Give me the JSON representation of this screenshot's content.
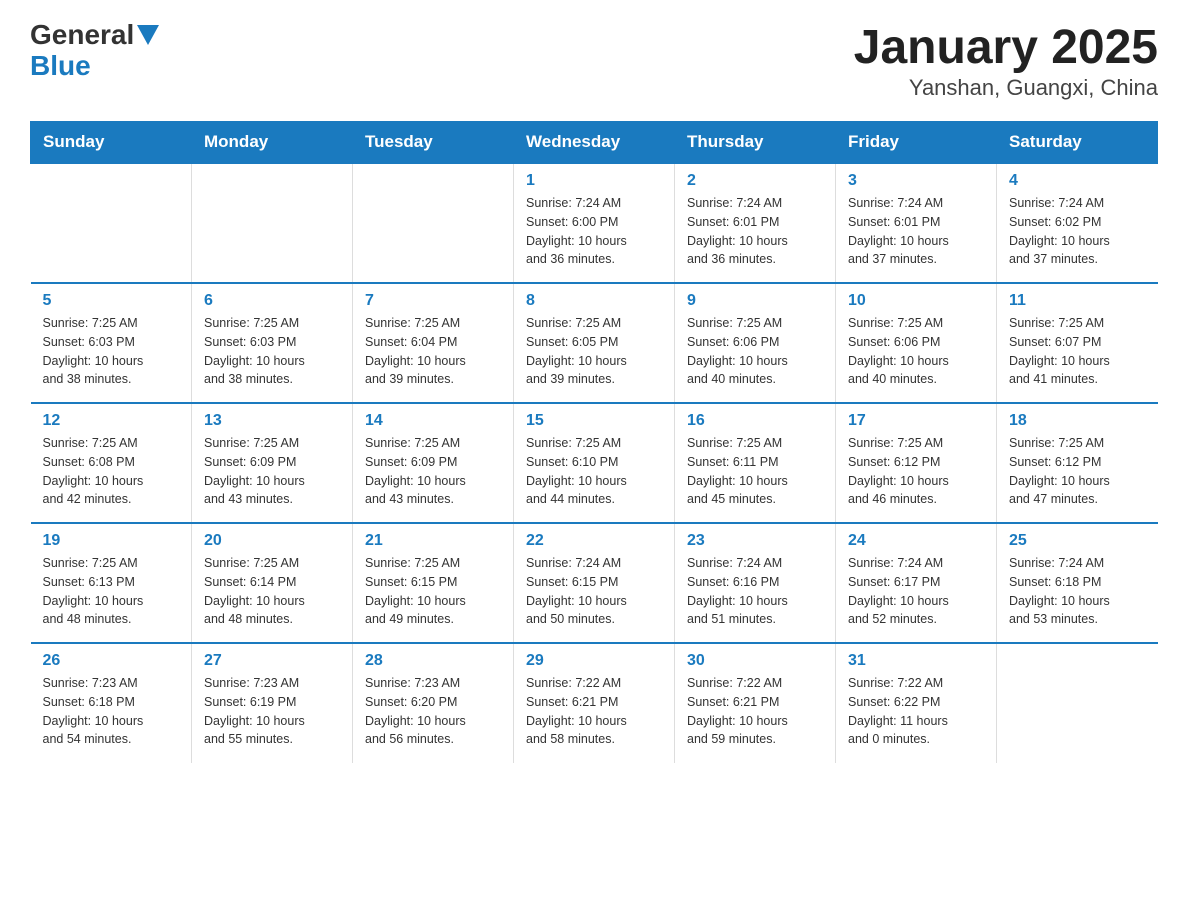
{
  "logo": {
    "general": "General",
    "blue": "Blue"
  },
  "header": {
    "title": "January 2025",
    "subtitle": "Yanshan, Guangxi, China"
  },
  "days_of_week": [
    "Sunday",
    "Monday",
    "Tuesday",
    "Wednesday",
    "Thursday",
    "Friday",
    "Saturday"
  ],
  "weeks": [
    [
      {
        "day": "",
        "info": ""
      },
      {
        "day": "",
        "info": ""
      },
      {
        "day": "",
        "info": ""
      },
      {
        "day": "1",
        "info": "Sunrise: 7:24 AM\nSunset: 6:00 PM\nDaylight: 10 hours\nand 36 minutes."
      },
      {
        "day": "2",
        "info": "Sunrise: 7:24 AM\nSunset: 6:01 PM\nDaylight: 10 hours\nand 36 minutes."
      },
      {
        "day": "3",
        "info": "Sunrise: 7:24 AM\nSunset: 6:01 PM\nDaylight: 10 hours\nand 37 minutes."
      },
      {
        "day": "4",
        "info": "Sunrise: 7:24 AM\nSunset: 6:02 PM\nDaylight: 10 hours\nand 37 minutes."
      }
    ],
    [
      {
        "day": "5",
        "info": "Sunrise: 7:25 AM\nSunset: 6:03 PM\nDaylight: 10 hours\nand 38 minutes."
      },
      {
        "day": "6",
        "info": "Sunrise: 7:25 AM\nSunset: 6:03 PM\nDaylight: 10 hours\nand 38 minutes."
      },
      {
        "day": "7",
        "info": "Sunrise: 7:25 AM\nSunset: 6:04 PM\nDaylight: 10 hours\nand 39 minutes."
      },
      {
        "day": "8",
        "info": "Sunrise: 7:25 AM\nSunset: 6:05 PM\nDaylight: 10 hours\nand 39 minutes."
      },
      {
        "day": "9",
        "info": "Sunrise: 7:25 AM\nSunset: 6:06 PM\nDaylight: 10 hours\nand 40 minutes."
      },
      {
        "day": "10",
        "info": "Sunrise: 7:25 AM\nSunset: 6:06 PM\nDaylight: 10 hours\nand 40 minutes."
      },
      {
        "day": "11",
        "info": "Sunrise: 7:25 AM\nSunset: 6:07 PM\nDaylight: 10 hours\nand 41 minutes."
      }
    ],
    [
      {
        "day": "12",
        "info": "Sunrise: 7:25 AM\nSunset: 6:08 PM\nDaylight: 10 hours\nand 42 minutes."
      },
      {
        "day": "13",
        "info": "Sunrise: 7:25 AM\nSunset: 6:09 PM\nDaylight: 10 hours\nand 43 minutes."
      },
      {
        "day": "14",
        "info": "Sunrise: 7:25 AM\nSunset: 6:09 PM\nDaylight: 10 hours\nand 43 minutes."
      },
      {
        "day": "15",
        "info": "Sunrise: 7:25 AM\nSunset: 6:10 PM\nDaylight: 10 hours\nand 44 minutes."
      },
      {
        "day": "16",
        "info": "Sunrise: 7:25 AM\nSunset: 6:11 PM\nDaylight: 10 hours\nand 45 minutes."
      },
      {
        "day": "17",
        "info": "Sunrise: 7:25 AM\nSunset: 6:12 PM\nDaylight: 10 hours\nand 46 minutes."
      },
      {
        "day": "18",
        "info": "Sunrise: 7:25 AM\nSunset: 6:12 PM\nDaylight: 10 hours\nand 47 minutes."
      }
    ],
    [
      {
        "day": "19",
        "info": "Sunrise: 7:25 AM\nSunset: 6:13 PM\nDaylight: 10 hours\nand 48 minutes."
      },
      {
        "day": "20",
        "info": "Sunrise: 7:25 AM\nSunset: 6:14 PM\nDaylight: 10 hours\nand 48 minutes."
      },
      {
        "day": "21",
        "info": "Sunrise: 7:25 AM\nSunset: 6:15 PM\nDaylight: 10 hours\nand 49 minutes."
      },
      {
        "day": "22",
        "info": "Sunrise: 7:24 AM\nSunset: 6:15 PM\nDaylight: 10 hours\nand 50 minutes."
      },
      {
        "day": "23",
        "info": "Sunrise: 7:24 AM\nSunset: 6:16 PM\nDaylight: 10 hours\nand 51 minutes."
      },
      {
        "day": "24",
        "info": "Sunrise: 7:24 AM\nSunset: 6:17 PM\nDaylight: 10 hours\nand 52 minutes."
      },
      {
        "day": "25",
        "info": "Sunrise: 7:24 AM\nSunset: 6:18 PM\nDaylight: 10 hours\nand 53 minutes."
      }
    ],
    [
      {
        "day": "26",
        "info": "Sunrise: 7:23 AM\nSunset: 6:18 PM\nDaylight: 10 hours\nand 54 minutes."
      },
      {
        "day": "27",
        "info": "Sunrise: 7:23 AM\nSunset: 6:19 PM\nDaylight: 10 hours\nand 55 minutes."
      },
      {
        "day": "28",
        "info": "Sunrise: 7:23 AM\nSunset: 6:20 PM\nDaylight: 10 hours\nand 56 minutes."
      },
      {
        "day": "29",
        "info": "Sunrise: 7:22 AM\nSunset: 6:21 PM\nDaylight: 10 hours\nand 58 minutes."
      },
      {
        "day": "30",
        "info": "Sunrise: 7:22 AM\nSunset: 6:21 PM\nDaylight: 10 hours\nand 59 minutes."
      },
      {
        "day": "31",
        "info": "Sunrise: 7:22 AM\nSunset: 6:22 PM\nDaylight: 11 hours\nand 0 minutes."
      },
      {
        "day": "",
        "info": ""
      }
    ]
  ]
}
